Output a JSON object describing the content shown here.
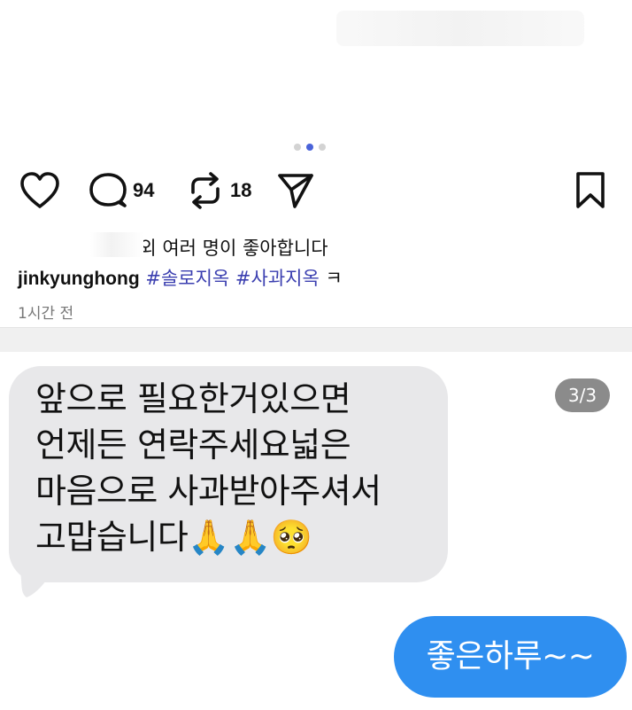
{
  "carousel": {
    "total": 3,
    "active_index": 1
  },
  "actions": {
    "like_icon": "heart-icon",
    "comment_icon": "comment-icon",
    "comment_count": "94",
    "repost_icon": "repost-icon",
    "repost_count": "18",
    "share_icon": "send-icon",
    "save_icon": "bookmark-icon"
  },
  "post": {
    "likes_text": "2님 외 여러 명이 좋아합니다",
    "username": "jinkyunghong",
    "hashtags": [
      "#솔로지옥",
      "#사과지옥"
    ],
    "caption_tail": "ㅋ",
    "time_ago": "1시간 전"
  },
  "chat": {
    "page_indicator": "3/3",
    "incoming_message": "앞으로 필요한거있으면\n언제든 연락주세요넓은\n마음으로 사과받아주셔서\n고맙습니다🙏🙏🥺",
    "outgoing_message": "좋은하루~~",
    "incoming_color": "#e8e8ea",
    "outgoing_color": "#2f8ff0"
  }
}
